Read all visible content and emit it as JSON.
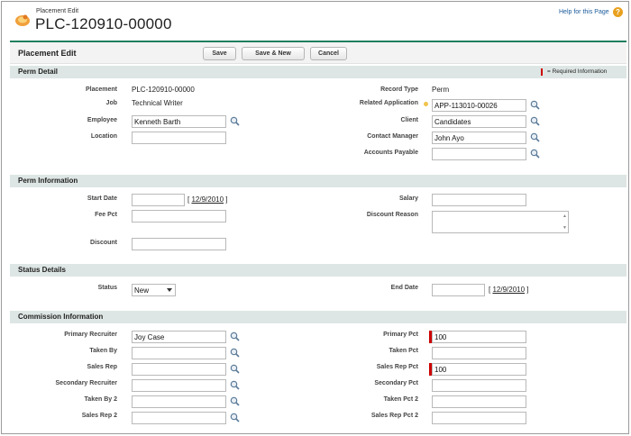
{
  "header": {
    "subtitle": "Placement Edit",
    "title": "PLC-120910-00000",
    "help_link": "Help for this Page",
    "help_icon": "?"
  },
  "toolbar": {
    "title": "Placement Edit",
    "save": "Save",
    "save_new": "Save & New",
    "cancel": "Cancel"
  },
  "sections": {
    "perm_detail": "Perm Detail",
    "perm_information": "Perm Information",
    "status_details": "Status Details",
    "commission_information": "Commission Information",
    "required_info": "= Required Information"
  },
  "perm_detail": {
    "placement_label": "Placement",
    "placement_value": "PLC-120910-00000",
    "job_label": "Job",
    "job_value": "Technical Writer",
    "employee_label": "Employee",
    "employee_value": "Kenneth Barth",
    "location_label": "Location",
    "location_value": "",
    "record_type_label": "Record Type",
    "record_type_value": "Perm",
    "related_app_label": "Related Application",
    "related_app_value": "APP-113010-00026",
    "client_label": "Client",
    "client_value": "Candidates",
    "contact_manager_label": "Contact Manager",
    "contact_manager_value": "John Ayo",
    "accounts_payable_label": "Accounts Payable",
    "accounts_payable_value": ""
  },
  "perm_info": {
    "start_date_label": "Start Date",
    "start_date_value": "",
    "start_date_link": "12/9/2010",
    "fee_pct_label": "Fee Pct",
    "fee_pct_value": "",
    "discount_label": "Discount",
    "discount_value": "",
    "salary_label": "Salary",
    "salary_value": "",
    "discount_reason_label": "Discount Reason",
    "discount_reason_value": ""
  },
  "status": {
    "status_label": "Status",
    "status_value": "New",
    "end_date_label": "End Date",
    "end_date_value": "",
    "end_date_link": "12/9/2010"
  },
  "commission": {
    "primary_recruiter_label": "Primary Recruiter",
    "primary_recruiter_value": "Joy Case",
    "taken_by_label": "Taken By",
    "taken_by_value": "",
    "sales_rep_label": "Sales Rep",
    "sales_rep_value": "",
    "secondary_recruiter_label": "Secondary Recruiter",
    "secondary_recruiter_value": "",
    "taken_by_2_label": "Taken By 2",
    "taken_by_2_value": "",
    "sales_rep_2_label": "Sales Rep 2",
    "sales_rep_2_value": "",
    "primary_pct_label": "Primary Pct",
    "primary_pct_value": "100",
    "taken_pct_label": "Taken Pct",
    "taken_pct_value": "",
    "sales_rep_pct_label": "Sales Rep Pct",
    "sales_rep_pct_value": "100",
    "secondary_pct_label": "Secondary Pct",
    "secondary_pct_value": "",
    "taken_pct_2_label": "Taken Pct 2",
    "taken_pct_2_value": "",
    "sales_rep_pct_2_label": "Sales Rep Pct 2",
    "sales_rep_pct_2_value": ""
  },
  "colors": {
    "accent_green": "#1f7f5e",
    "section_bg": "#dde6e4",
    "required_red": "#cc0000",
    "link_blue": "#1a5a9a"
  },
  "icons": {
    "page_icon": "placement-icon",
    "lookup": "lookup-magnifier-icon",
    "help": "help-icon"
  }
}
